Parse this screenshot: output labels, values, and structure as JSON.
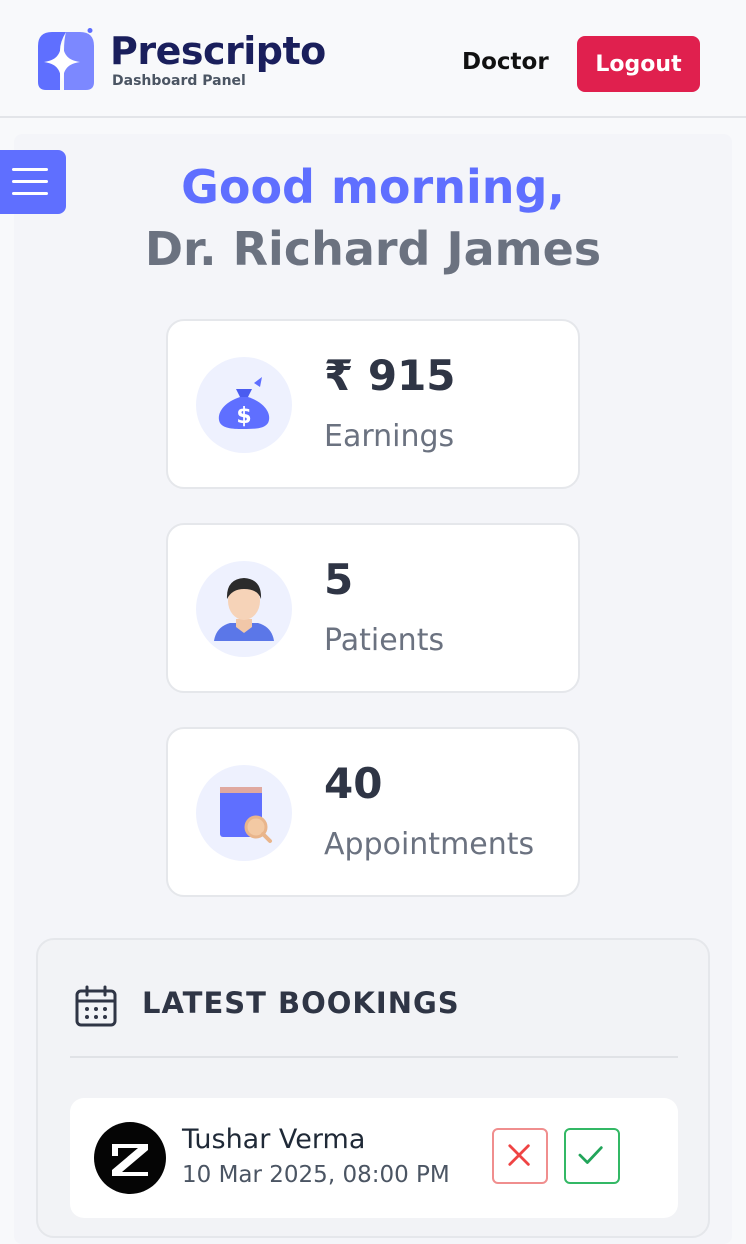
{
  "header": {
    "brand": "Prescripto",
    "subtitle": "Dashboard Panel",
    "role": "Doctor",
    "logout_label": "Logout"
  },
  "greeting": {
    "line1": "Good morning,",
    "line2": "Dr. Richard James"
  },
  "stats": [
    {
      "value": "₹ 915",
      "label": "Earnings",
      "icon": "money-bag-icon"
    },
    {
      "value": "5",
      "label": "Patients",
      "icon": "patient-icon"
    },
    {
      "value": "40",
      "label": "Appointments",
      "icon": "appointment-book-icon"
    }
  ],
  "bookings": {
    "title": "LATEST BOOKINGS",
    "items": [
      {
        "name": "Tushar Verma",
        "datetime": "10 Mar 2025, 08:00 PM"
      }
    ]
  },
  "colors": {
    "primary": "#5f6fff",
    "brand_text": "#1a1f5c",
    "logout": "#e0204e",
    "cancel": "#ef4444",
    "confirm": "#22a55a"
  }
}
